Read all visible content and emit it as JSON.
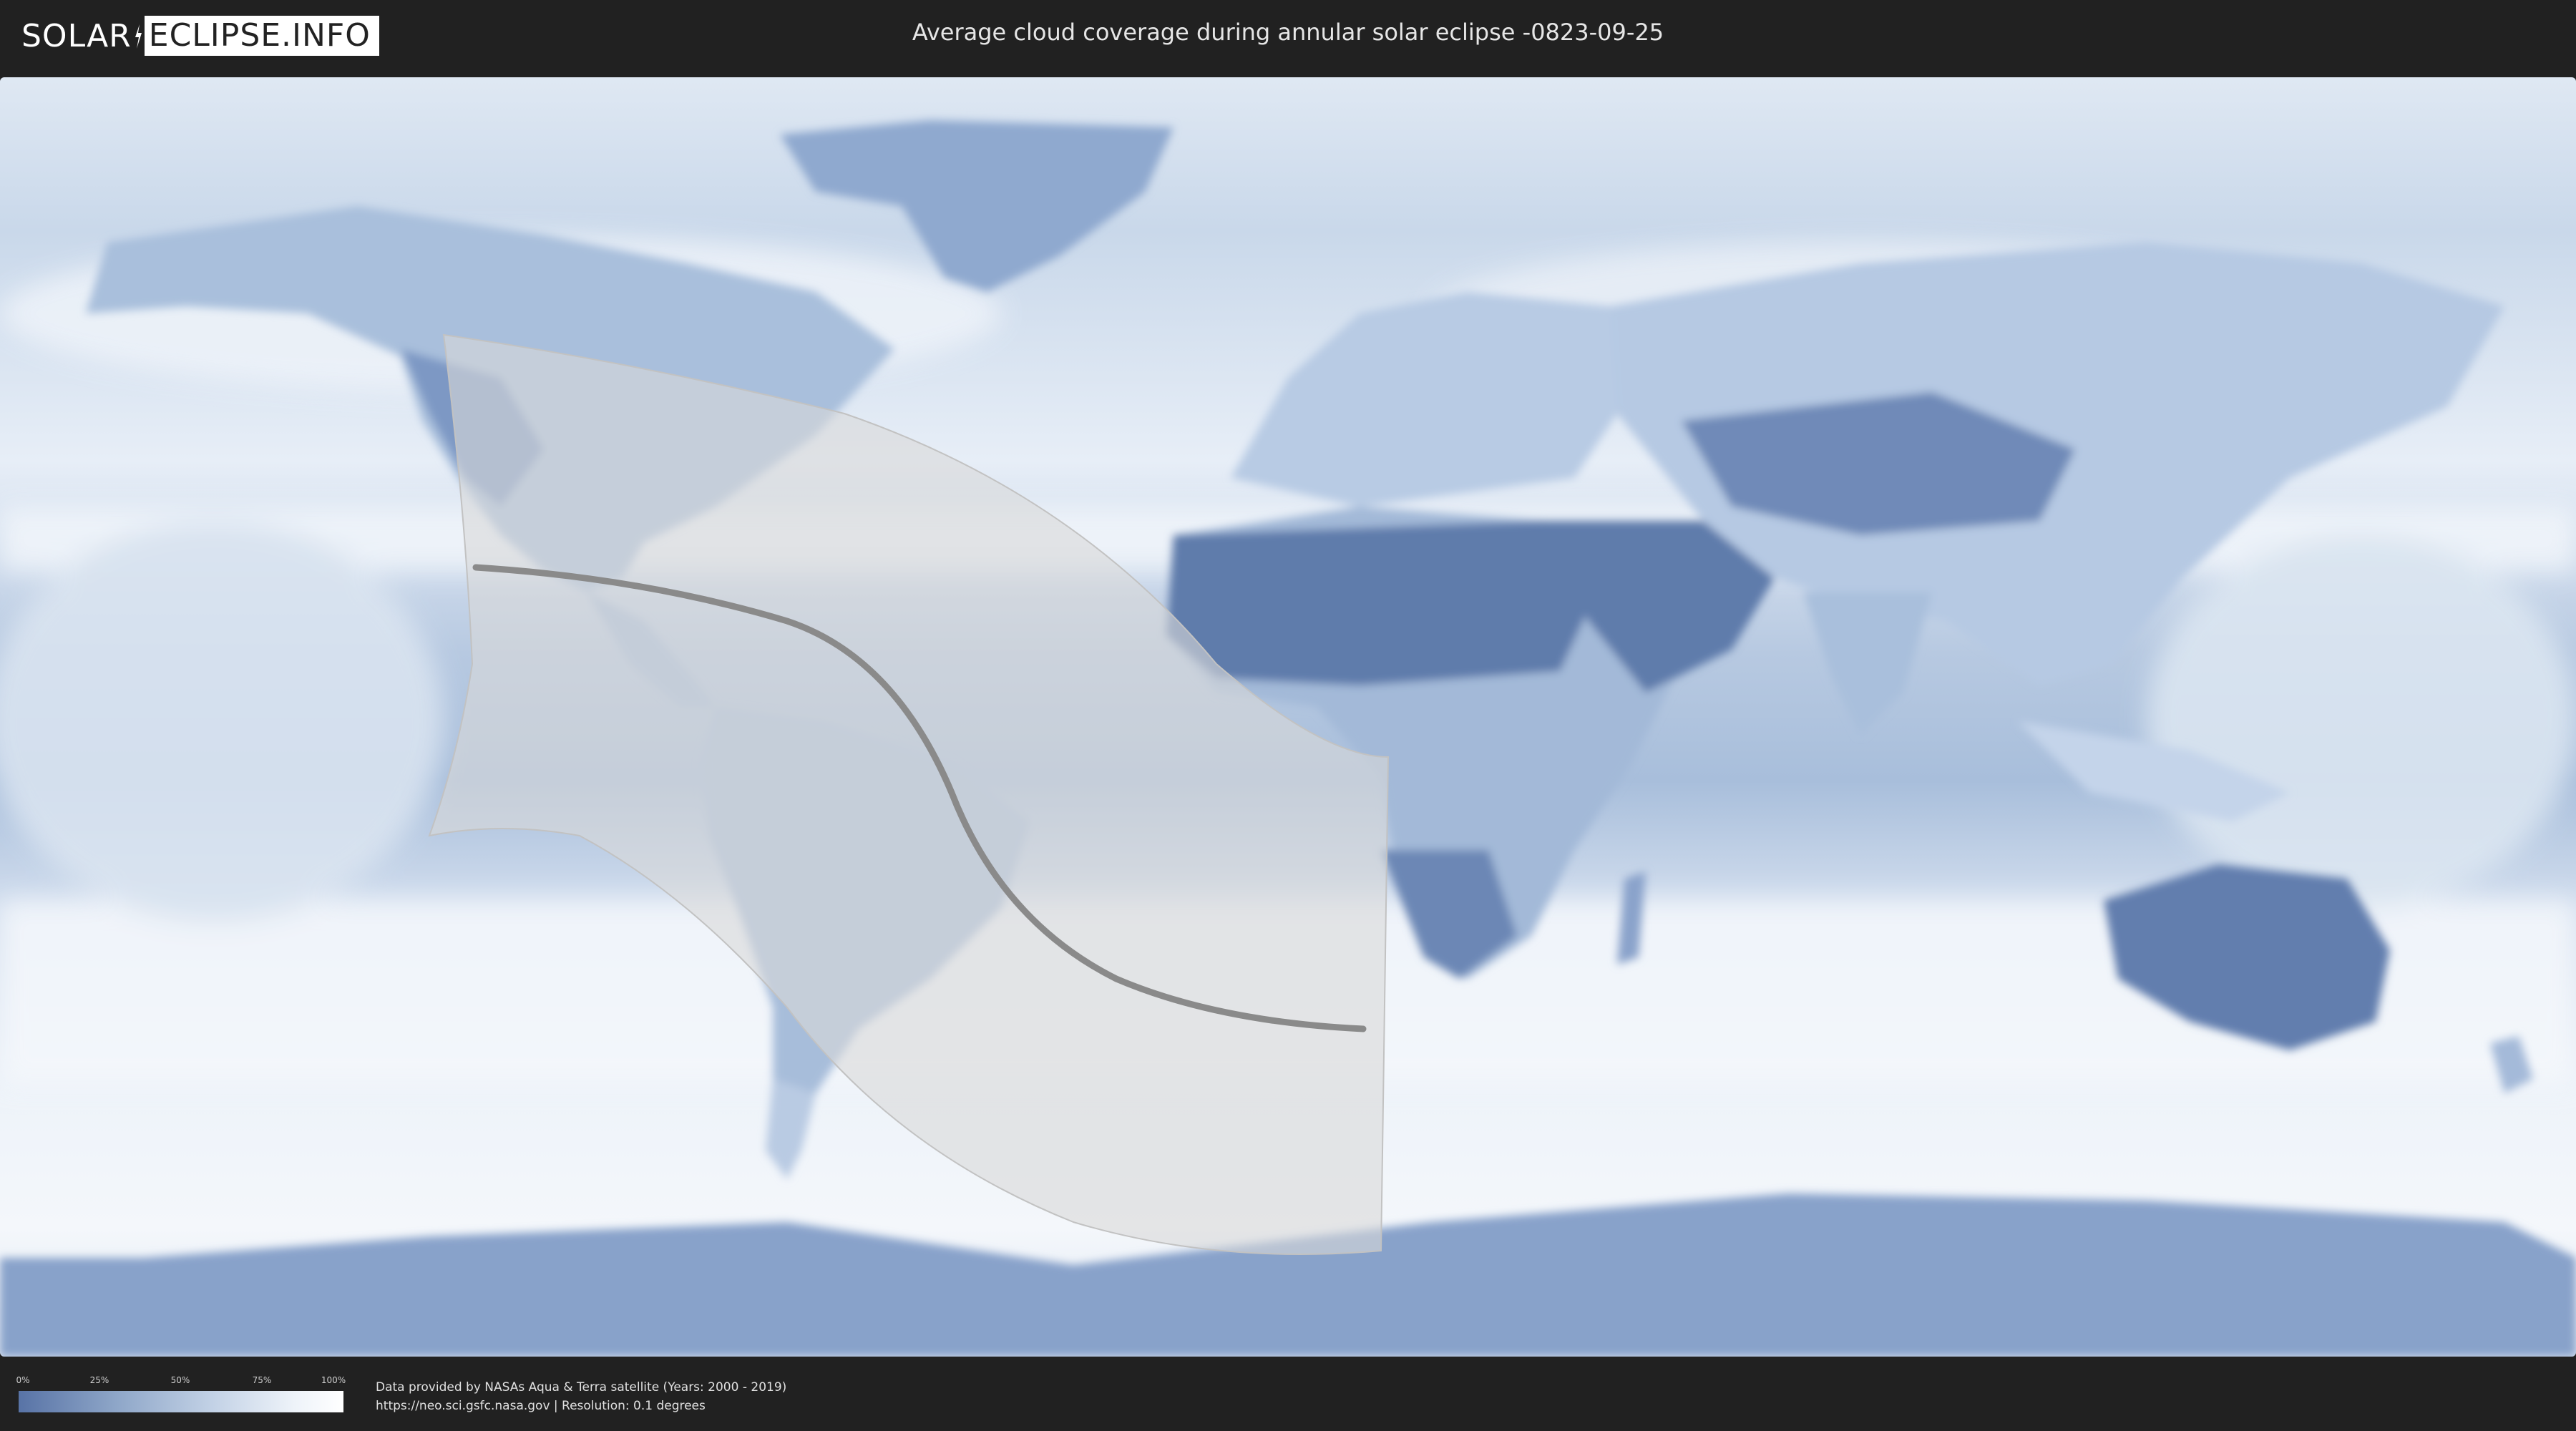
{
  "header": {
    "logo_left": "SOLAR",
    "logo_right": "ECLIPSE.INFO",
    "title": "Average cloud coverage during annular solar eclipse -0823-09-25"
  },
  "legend": {
    "ticks": [
      "0%",
      "25%",
      "50%",
      "75%",
      "100%"
    ],
    "colors": [
      "#5873a6",
      "#ffffff"
    ]
  },
  "footer": {
    "line1": "Data provided by NASAs Aqua & Terra satellite (Years: 2000 - 2019)",
    "line2": "https://neo.sci.gsfc.nasa.gov | Resolution: 0.1 degrees"
  },
  "colors": {
    "ocean_clear": "#7f9cc8",
    "cloud": "#eef3f9",
    "dry_land": "#5a76a8",
    "eclipse_zone": "#d9d9d9",
    "central_line": "#8a8a8a"
  }
}
